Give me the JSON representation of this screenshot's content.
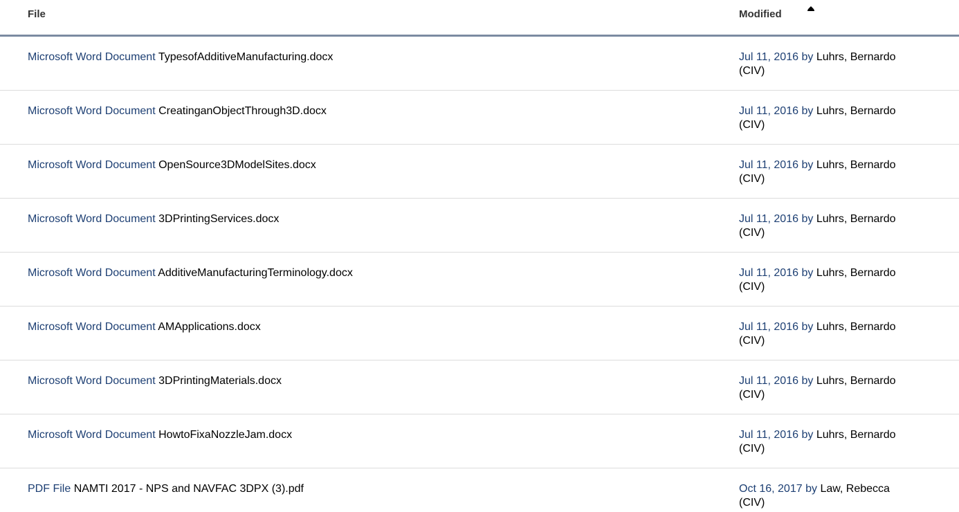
{
  "header": {
    "file_label": "File",
    "modified_label": "Modified",
    "sort_icon": "sort-ascending-icon"
  },
  "colors": {
    "link": "#1d3f73",
    "header_rule": "#7b8ba1",
    "row_divider": "#dcdcdc"
  },
  "rows": [
    {
      "type": "Microsoft Word Document",
      "name": "TypesofAdditiveManufacturing.docx",
      "date": "Jul 11, 2016",
      "by": "by",
      "user": "Luhrs, Bernardo",
      "user2": "(CIV)"
    },
    {
      "type": "Microsoft Word Document",
      "name": "CreatinganObjectThrough3D.docx",
      "date": "Jul 11, 2016",
      "by": "by",
      "user": "Luhrs, Bernardo",
      "user2": "(CIV)"
    },
    {
      "type": "Microsoft Word Document",
      "name": "OpenSource3DModelSites.docx",
      "date": "Jul 11, 2016",
      "by": "by",
      "user": "Luhrs, Bernardo",
      "user2": "(CIV)"
    },
    {
      "type": "Microsoft Word Document",
      "name": "3DPrintingServices.docx",
      "date": "Jul 11, 2016",
      "by": "by",
      "user": "Luhrs, Bernardo",
      "user2": "(CIV)"
    },
    {
      "type": "Microsoft Word Document",
      "name": "AdditiveManufacturingTerminology.docx",
      "date": "Jul 11, 2016",
      "by": "by",
      "user": "Luhrs, Bernardo",
      "user2": "(CIV)"
    },
    {
      "type": "Microsoft Word Document",
      "name": "AMApplications.docx",
      "date": "Jul 11, 2016",
      "by": "by",
      "user": "Luhrs, Bernardo",
      "user2": "(CIV)"
    },
    {
      "type": "Microsoft Word Document",
      "name": "3DPrintingMaterials.docx",
      "date": "Jul 11, 2016",
      "by": "by",
      "user": "Luhrs, Bernardo",
      "user2": "(CIV)"
    },
    {
      "type": "Microsoft Word Document",
      "name": "HowtoFixaNozzleJam.docx",
      "date": "Jul 11, 2016",
      "by": "by",
      "user": "Luhrs, Bernardo",
      "user2": "(CIV)"
    },
    {
      "type": "PDF File",
      "name": "NAMTI 2017 - NPS and NAVFAC 3DPX (3).pdf",
      "date": "Oct 16, 2017",
      "by": "by",
      "user": "Law, Rebecca",
      "user2": "(CIV)"
    }
  ]
}
